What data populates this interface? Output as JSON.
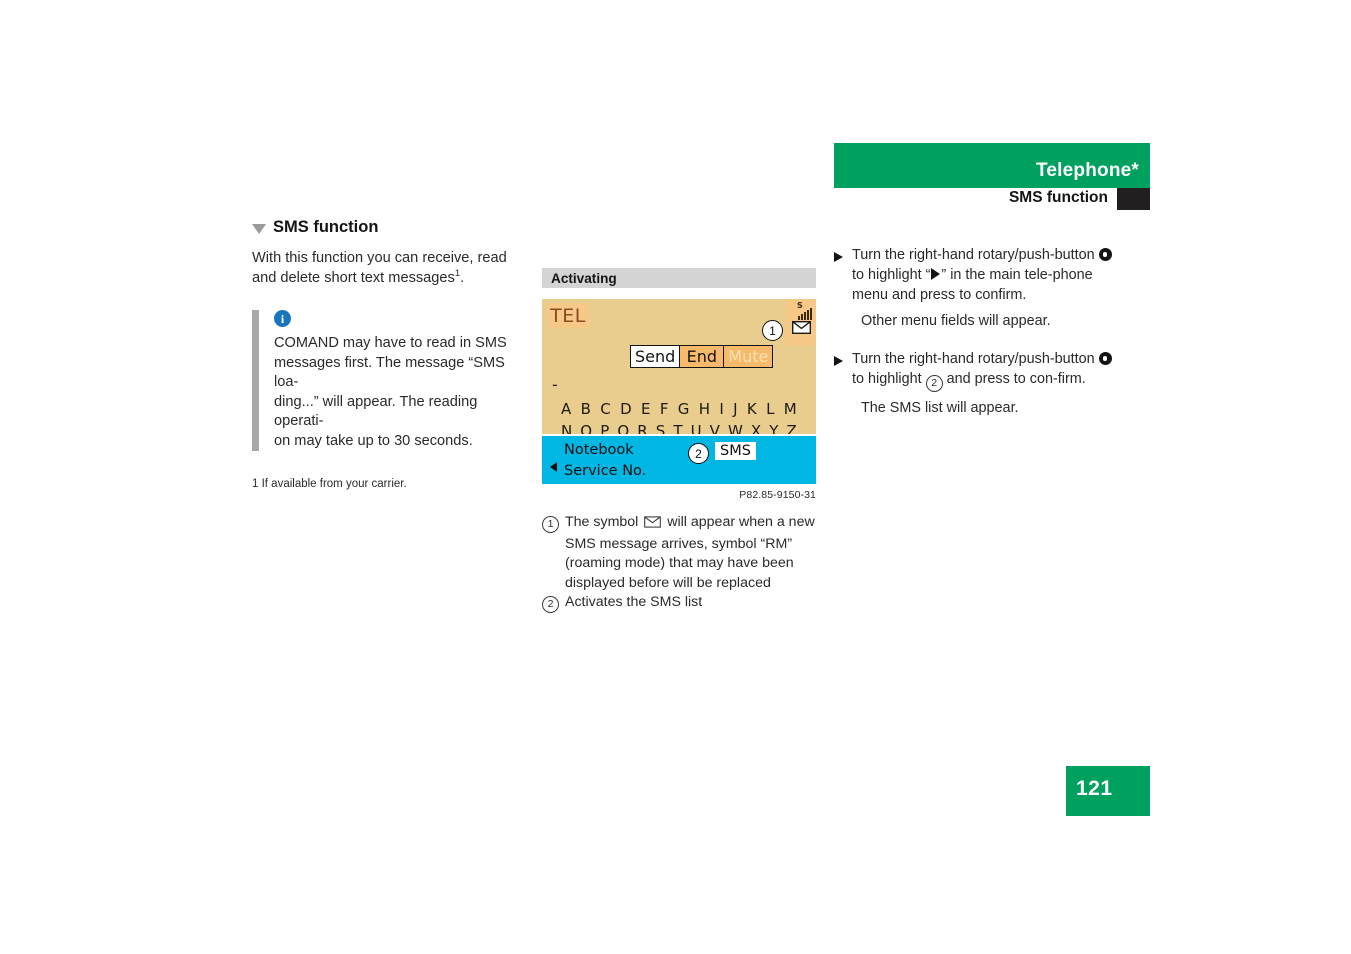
{
  "header": {
    "chapter_title": "Telephone*",
    "section_title": "SMS function",
    "accent_color": "#00a05e",
    "tab_color": "#231f20"
  },
  "page_number": "121",
  "left_column": {
    "heading": "SMS function",
    "intro_line1": "With this function you can receive, read",
    "intro_line2": "and delete short text messages",
    "intro_footnote_marker": "1",
    "intro_period": ".",
    "note": {
      "icon": "info-icon",
      "line1": "COMAND may have to read in SMS",
      "line2": "messages first. The message “SMS loa-",
      "line3": "ding...” will appear. The reading operati-",
      "line4": "on may take up to 30 seconds."
    },
    "footnote": "1 If available from your carrier."
  },
  "center_column": {
    "figure_caption_bar": "Activating",
    "figure_id": "P82.85-9150-31",
    "display": {
      "background_color": "#e9cd8e",
      "tel_tab_label": "TEL",
      "status_roaming_letter": "S",
      "signal_icon": "signal-bars-icon",
      "message_icon": "envelope-icon",
      "callout_1": "1",
      "softkeys": [
        {
          "label": "Send",
          "state": "active"
        },
        {
          "label": "End",
          "state": "normal"
        },
        {
          "label": "Mute",
          "state": "disabled"
        }
      ],
      "input_cursor": "-",
      "alphabet_row_1": [
        "A",
        "B",
        "C",
        "D",
        "E",
        "F",
        "G",
        "H",
        "I",
        "J",
        "K",
        "L",
        "M"
      ],
      "alphabet_row_2": [
        "N",
        "O",
        "P",
        "Q",
        "R",
        "S",
        "T",
        "U",
        "V",
        "W",
        "X",
        "Y",
        "Z"
      ],
      "bottom_bar": {
        "background_color": "#00b6e3",
        "item_1": "Notebook",
        "item_2": "Service No.",
        "callout_2": "2",
        "sms_key_label": "SMS"
      }
    },
    "legend": [
      {
        "num": "1",
        "text_before": "The symbol",
        "symbol": "envelope-icon",
        "text_after": "will appear when a new SMS message arrives, symbol “RM” (roaming mode) that may have been displayed before will be replaced"
      },
      {
        "num": "2",
        "text_before": "Activates the SMS list",
        "symbol": "",
        "text_after": ""
      }
    ]
  },
  "right_column": {
    "steps": [
      {
        "arrow": "step-arrow-icon",
        "text_part_1": "Turn the right-hand rotary/push-button",
        "knob": "rotary-push-button-icon",
        "text_part_2": "to highlight “",
        "glyph": "triangle-right-icon",
        "text_part_3": "” in the main tele-phone menu and press to confirm.",
        "result": "Other menu fields will appear."
      },
      {
        "arrow": "step-arrow-icon",
        "text_part_1": "Turn the right-hand rotary/push-button",
        "knob": "rotary-push-button-icon",
        "text_part_2": "to highlight",
        "glyph": "2",
        "text_part_3": "and press to con-firm.",
        "result": "The SMS list will appear."
      }
    ]
  }
}
